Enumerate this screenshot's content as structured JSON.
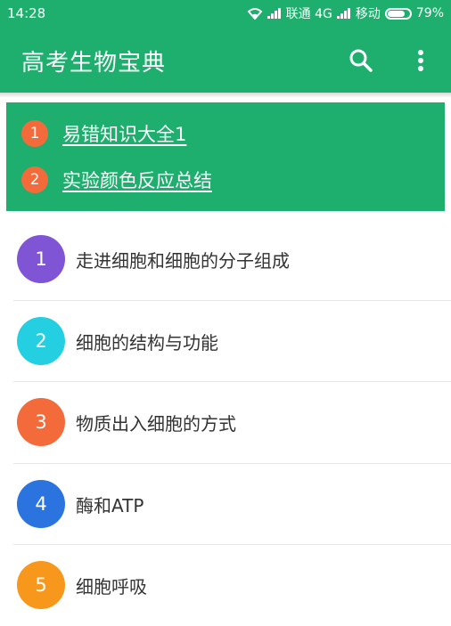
{
  "status_bar": {
    "time": "14:28",
    "carrier1": "联通 4G",
    "carrier2": "移动",
    "battery": "79%",
    "battery_level": 0.79
  },
  "toolbar": {
    "title": "高考生物宝典",
    "search_icon": "search-icon",
    "menu_icon": "more-vert-icon"
  },
  "colors": {
    "primary": "#1eaf6e",
    "banner_badge": "#f36b3b"
  },
  "banner": [
    {
      "num": "1",
      "label": "易错知识大全1"
    },
    {
      "num": "2",
      "label": "实验颜色反应总结"
    }
  ],
  "chapters": [
    {
      "num": "1",
      "label": "走进细胞和细胞的分子组成",
      "color": "#7f55d5"
    },
    {
      "num": "2",
      "label": "细胞的结构与功能",
      "color": "#23cfe0"
    },
    {
      "num": "3",
      "label": "物质出入细胞的方式",
      "color": "#f36b3b"
    },
    {
      "num": "4",
      "label": "酶和ATP",
      "color": "#2b74e0"
    },
    {
      "num": "5",
      "label": "细胞呼吸",
      "color": "#f7981d"
    }
  ]
}
